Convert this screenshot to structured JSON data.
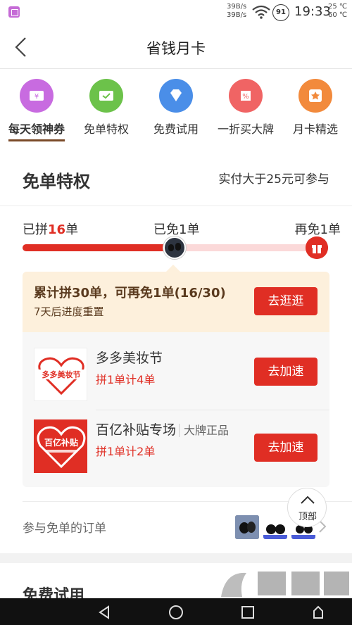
{
  "status_bar": {
    "net_speed_up": "39B/s",
    "net_speed_down": "39B/s",
    "battery": "91",
    "time": "19:33",
    "temp_1": "25 ℃",
    "temp_2": "60 ℃"
  },
  "nav": {
    "title": "省钱月卡"
  },
  "categories": [
    {
      "label": "每天领神券",
      "icon": "coupon-icon",
      "color": "#c86be0",
      "active": true
    },
    {
      "label": "免单特权",
      "icon": "check-card-icon",
      "color": "#6cc24a",
      "active": false
    },
    {
      "label": "免费试用",
      "icon": "diamond-icon",
      "color": "#4a8ee8",
      "active": false
    },
    {
      "label": "一折买大牌",
      "icon": "percent-icon",
      "color": "#f06464",
      "active": false
    },
    {
      "label": "月卡精选",
      "icon": "star-icon",
      "color": "#f28a3c",
      "active": false
    }
  ],
  "free_order": {
    "title": "免单特权",
    "note": "实付大于25元可参与",
    "progress": {
      "left_label_prefix": "已拼",
      "left_count": "16",
      "left_label_suffix": "单",
      "mid_label": "已免1单",
      "right_label": "再免1单",
      "fraction": 0.53
    },
    "panel": {
      "title": "累计拼30单，可再免1单(16/30)",
      "subtitle": "7天后进度重置",
      "button": "去逛逛"
    },
    "items": [
      {
        "name": "多多美妆节",
        "tag": "",
        "sub": "拼1单计4单",
        "button": "去加速",
        "logo_text": "多多美妆节"
      },
      {
        "name": "百亿补贴专场",
        "tag": "大牌正品",
        "sub": "拼1单计2单",
        "button": "去加速",
        "logo_text": "百亿补贴"
      }
    ],
    "orders_label": "参与免单的订单"
  },
  "top_button": {
    "label": "顶部"
  },
  "next_section": {
    "title": "免费试用"
  },
  "colors": {
    "accent": "#e02e24",
    "brown": "#7a4a28",
    "panel_bg": "#fdf0dc"
  }
}
